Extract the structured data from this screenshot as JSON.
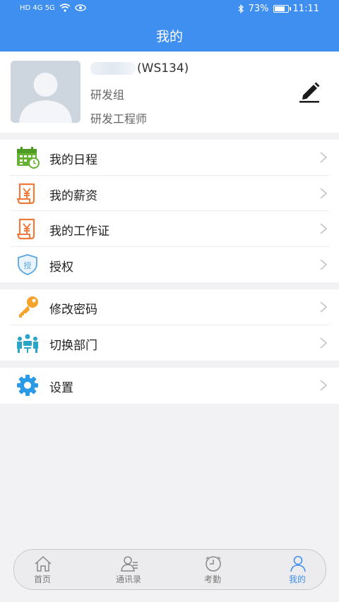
{
  "status_bar": {
    "left_indicators": "HD 4G 5G",
    "battery": "73%",
    "battery_level": 0.73,
    "time": "11:11"
  },
  "nav": {
    "title": "我的"
  },
  "profile": {
    "employee_id": "(WS134)",
    "department": "研发组",
    "position": "研发工程师"
  },
  "menu_groups": [
    [
      {
        "label": "我的日程",
        "icon": "calendar-icon"
      },
      {
        "label": "我的薪资",
        "icon": "salary-scroll-icon"
      },
      {
        "label": "我的工作证",
        "icon": "work-permit-icon"
      },
      {
        "label": "授权",
        "icon": "authorize-shield-icon"
      }
    ],
    [
      {
        "label": "修改密码",
        "icon": "key-icon"
      },
      {
        "label": "切换部门",
        "icon": "team-switch-icon"
      }
    ],
    [
      {
        "label": "设置",
        "icon": "gear-icon"
      }
    ]
  ],
  "tabs": [
    {
      "label": "首页",
      "icon": "home-icon"
    },
    {
      "label": "通讯录",
      "icon": "contacts-icon"
    },
    {
      "label": "考勤",
      "icon": "clock-icon"
    },
    {
      "label": "我的",
      "icon": "person-icon",
      "active": true
    }
  ],
  "colors": {
    "primary": "#3f8ff0",
    "calendar_green": "#67b233",
    "salary_orange": "#ee7b3c",
    "key_orange": "#f5a32a",
    "team_teal": "#2aa4c8",
    "gear_blue": "#2a9ae6"
  }
}
